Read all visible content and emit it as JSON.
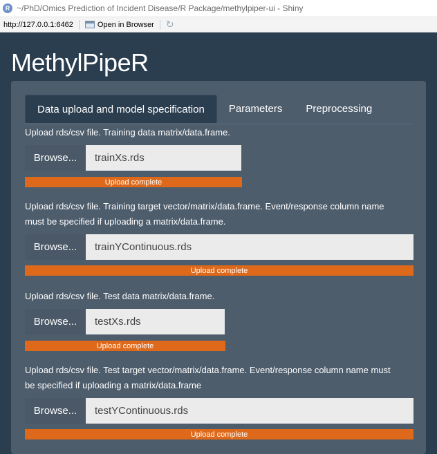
{
  "window": {
    "logo": "R",
    "title": "~/PhD/Omics Prediction of Incident Disease/R Package/methylpiper-ui - Shiny"
  },
  "toolbar": {
    "url": "http://127.0.0.1:6462",
    "open_in_browser": "Open in Browser",
    "refresh_icon": "refresh-icon"
  },
  "app": {
    "title": "MethylPipeR"
  },
  "tabs": [
    {
      "label": "Data upload and model specification"
    },
    {
      "label": "Parameters"
    },
    {
      "label": "Preprocessing"
    }
  ],
  "uploads": [
    {
      "label_line1": "Upload rds/csv file. Training data matrix/data.frame.",
      "label_line2": "",
      "browse": "Browse...",
      "filename": "trainXs.rds",
      "status": "Upload complete",
      "progress": 1.0
    },
    {
      "label_line1": "Upload rds/csv file. Training target vector/matrix/data.frame. Event/response column name",
      "label_line2": "must be specified if uploading a matrix/data.frame.",
      "browse": "Browse...",
      "filename": "trainYContinuous.rds",
      "status": "Upload complete",
      "progress": 1.0
    },
    {
      "label_line1": "Upload rds/csv file. Test data matrix/data.frame.",
      "label_line2": "",
      "browse": "Browse...",
      "filename": "testXs.rds",
      "status": "Upload complete",
      "progress": 1.0
    },
    {
      "label_line1": "Upload rds/csv file. Test target vector/matrix/data.frame. Event/response column name must",
      "label_line2": "be specified if uploading a matrix/data.frame",
      "browse": "Browse...",
      "filename": "testYContinuous.rds",
      "status": "Upload complete",
      "progress": 1.0
    }
  ],
  "colors": {
    "background": "#2b3e50",
    "panel": "#4e5d6c",
    "progress": "#df691a",
    "browse_button": "#4a5867"
  }
}
